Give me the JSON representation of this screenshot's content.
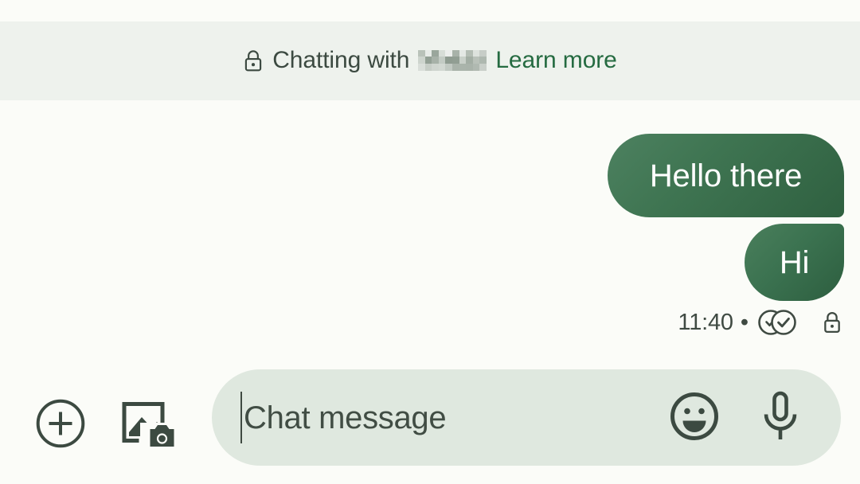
{
  "app": {
    "background_color": "#fbfcf8",
    "accent_color": "#2f6040"
  },
  "banner": {
    "lock_icon": "lock-icon",
    "text_prefix": "Chatting with",
    "contact_name_redacted": "█████",
    "link_label": "Learn more",
    "link_color": "#256b41",
    "background_color": "#eef2ed"
  },
  "conversation": {
    "messages": [
      {
        "id": "msg-1",
        "text": "Hello there",
        "direction": "outgoing",
        "bubble_color": "#3f7552"
      },
      {
        "id": "msg-2",
        "text": "Hi",
        "direction": "outgoing",
        "bubble_color": "#3b7250"
      }
    ],
    "status": {
      "time": "11:40",
      "separator": "•",
      "delivery_icon": "double-check-delivered-icon",
      "encryption_icon": "lock-icon"
    }
  },
  "composer": {
    "attach_icon": "plus-circle-icon",
    "gallery_icon": "image-camera-icon",
    "input": {
      "value": "",
      "placeholder": "Chat message",
      "background_color": "#dfe8df"
    },
    "emoji_icon": "emoji-smiley-icon",
    "mic_icon": "microphone-icon"
  }
}
